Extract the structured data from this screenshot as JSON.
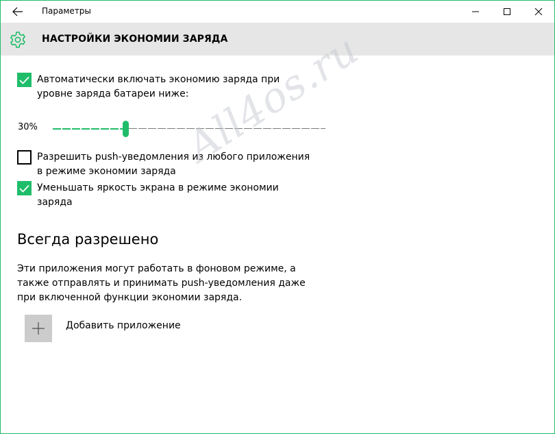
{
  "window": {
    "app_title": "Параметры",
    "accent_color": "#1fbd6a"
  },
  "titlebar": {
    "back_icon": "arrow-left-icon",
    "minimize_icon": "minimize-icon",
    "maximize_icon": "maximize-icon",
    "close_icon": "close-icon"
  },
  "header": {
    "icon": "gear-icon",
    "title": "НАСТРОЙКИ ЭКОНОМИИ ЗАРЯДА"
  },
  "settings": {
    "auto_saver": {
      "checked": true,
      "label": "Автоматически включать экономию заряда при уровне заряда батареи ниже:"
    },
    "threshold": {
      "value_label": "30%",
      "value": 30
    },
    "push_notifications": {
      "checked": false,
      "label": "Разрешить push-уведомления из любого приложения в режиме экономии заряда"
    },
    "lower_brightness": {
      "checked": true,
      "label": "Уменьшать яркость экрана в режиме экономии заряда"
    }
  },
  "always_allowed": {
    "title": "Всегда разрешено",
    "description": "Эти приложения могут работать в фоновом режиме, а также отправлять и принимать push-уведомления даже при включенной функции экономии заряда.",
    "add_icon": "plus-icon",
    "add_label": "Добавить приложение"
  },
  "watermark": {
    "text": "All4os.ru"
  }
}
